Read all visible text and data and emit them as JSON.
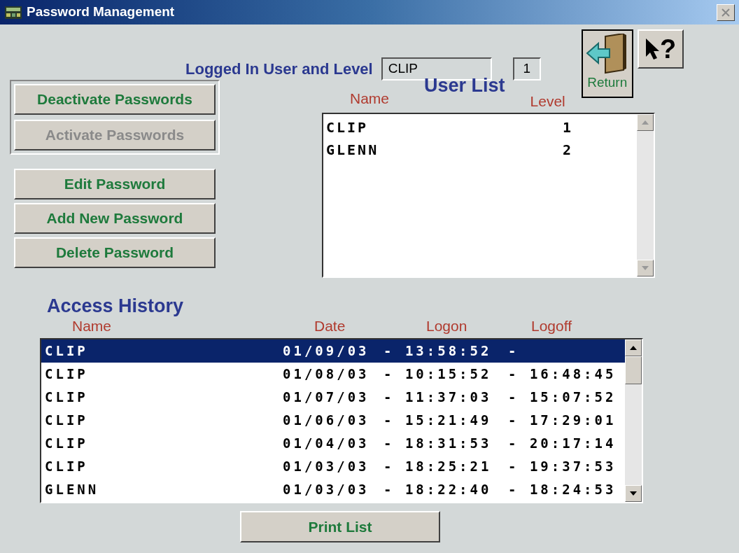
{
  "window": {
    "title": "Password Management"
  },
  "logged_in": {
    "label": "Logged In User and Level",
    "user": "CLIP",
    "level": "1"
  },
  "return_button": {
    "label": "Return"
  },
  "help_button": {
    "glyph": "?"
  },
  "password_group": [
    {
      "label": "Deactivate Passwords",
      "disabled": false
    },
    {
      "label": "Activate Passwords",
      "disabled": true
    }
  ],
  "password_actions": [
    {
      "label": "Edit Password",
      "disabled": false
    },
    {
      "label": "Add New Password",
      "disabled": false
    },
    {
      "label": "Delete Password",
      "disabled": false
    }
  ],
  "user_list": {
    "title": "User List",
    "columns": [
      "Name",
      "Level"
    ],
    "rows": [
      {
        "name": "CLIP",
        "level": "1",
        "selected": false
      },
      {
        "name": "GLENN",
        "level": "2",
        "selected": false
      }
    ]
  },
  "access_history": {
    "title": "Access History",
    "columns": [
      "Name",
      "Date",
      "Logon",
      "Logoff"
    ],
    "rows": [
      {
        "cells": [
          "CLIP",
          "01/09/03",
          "- 13:58:52",
          "-"
        ],
        "selected": true
      },
      {
        "cells": [
          "CLIP",
          "01/08/03",
          "- 10:15:52",
          "- 16:48:45"
        ],
        "selected": false
      },
      {
        "cells": [
          "CLIP",
          "01/07/03",
          "- 11:37:03",
          "- 15:07:52"
        ],
        "selected": false
      },
      {
        "cells": [
          "CLIP",
          "01/06/03",
          "- 15:21:49",
          "- 17:29:01"
        ],
        "selected": false
      },
      {
        "cells": [
          "CLIP",
          "01/04/03",
          "- 18:31:53",
          "- 20:17:14"
        ],
        "selected": false
      },
      {
        "cells": [
          "CLIP",
          "01/03/03",
          "- 18:25:21",
          "- 19:37:53"
        ],
        "selected": false
      },
      {
        "cells": [
          "GLENN",
          "01/03/03",
          "- 18:22:40",
          "- 18:24:53"
        ],
        "selected": false
      }
    ]
  },
  "print_button": {
    "label": "Print List"
  }
}
